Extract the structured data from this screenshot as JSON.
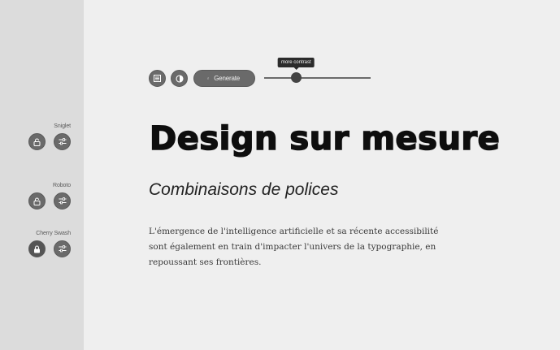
{
  "sidebar": {
    "fonts": [
      {
        "name": "Sniglet",
        "lock_locked": false
      },
      {
        "name": "Roboto",
        "lock_locked": false
      },
      {
        "name": "Cherry Swash",
        "lock_locked": true
      }
    ]
  },
  "toolbar": {
    "generate_label": "Generate"
  },
  "slider": {
    "tooltip": "more contrast",
    "value_fraction": 0.3
  },
  "content": {
    "headline": "Design sur mesure",
    "subtitle": "Combinaisons de polices",
    "paragraph": "L'émergence de l'intelligence artificielle et sa récente accessibilité sont également en train d'impacter l'univers de la typographie, en repoussant ses frontières."
  }
}
